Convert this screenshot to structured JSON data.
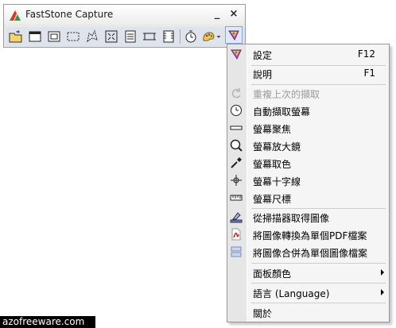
{
  "window": {
    "title": "FastStone Capture",
    "minimize_symbol": "_",
    "close_symbol": "×"
  },
  "toolbar": {
    "tools": [
      {
        "icon": "open-folder-icon"
      },
      {
        "icon": "capture-window-icon"
      },
      {
        "icon": "capture-object-icon"
      },
      {
        "icon": "capture-rectangle-icon"
      },
      {
        "icon": "capture-freehand-icon"
      },
      {
        "icon": "capture-fullscreen-icon"
      },
      {
        "icon": "capture-scrolling-icon"
      },
      {
        "icon": "capture-fixed-region-icon"
      },
      {
        "icon": "video-recorder-icon"
      },
      {
        "icon": "delay-timer-icon"
      },
      {
        "icon": "output-destination-icon"
      },
      {
        "icon": "settings-menu-icon"
      }
    ]
  },
  "menu": {
    "items": [
      {
        "label": "設定",
        "shortcut": "F12",
        "icon": "settings-icon"
      },
      {
        "label": "說明",
        "shortcut": "F1",
        "icon": ""
      },
      {
        "label": "重複上次的擷取",
        "icon": "repeat-capture-icon",
        "disabled": true
      },
      {
        "label": "自動擷取螢幕",
        "icon": "clock-icon"
      },
      {
        "label": "螢幕聚焦",
        "icon": "screen-spotlight-icon"
      },
      {
        "label": "螢幕放大鏡",
        "icon": "magnifier-icon"
      },
      {
        "label": "螢幕取色",
        "icon": "color-picker-icon"
      },
      {
        "label": "螢幕十字線",
        "icon": "crosshair-icon"
      },
      {
        "label": "螢幕尺標",
        "icon": "ruler-icon"
      },
      {
        "label": "從掃描器取得圖像",
        "icon": "scanner-icon"
      },
      {
        "label": "將圖像轉換為單個PDF檔案",
        "icon": "pdf-icon"
      },
      {
        "label": "將圖像合併為單個圖像檔案",
        "icon": "merge-images-icon"
      },
      {
        "label": "面板顏色",
        "icon": "",
        "submenu": true
      },
      {
        "label": "語言 (Language)",
        "icon": "",
        "submenu": true
      },
      {
        "label": "關於",
        "icon": ""
      }
    ]
  },
  "watermark": "azofreeware.com",
  "colors": {
    "menu_background": "#f5f5f5",
    "menu_gutter": "#e6e6e6",
    "disabled_text": "#9a9a9a",
    "toolbar_background": "#dfe3ec"
  }
}
